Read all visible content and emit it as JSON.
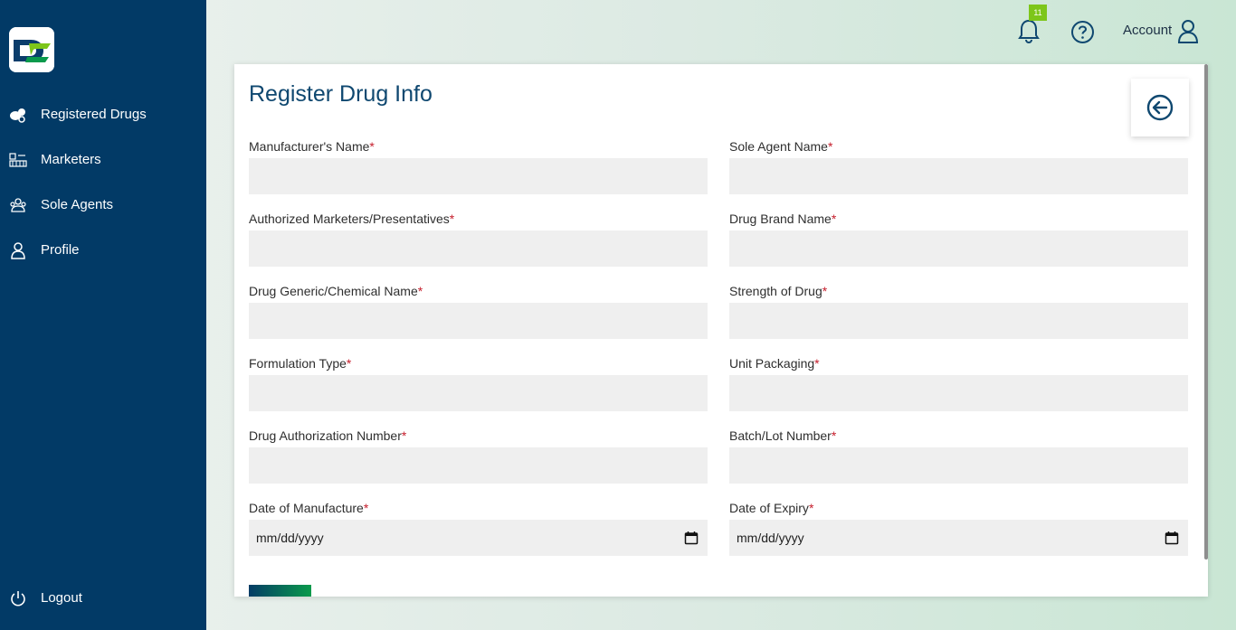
{
  "sidebar": {
    "items": [
      {
        "label": "Registered Drugs",
        "icon": "pills-icon"
      },
      {
        "label": "Marketers",
        "icon": "marketers-icon"
      },
      {
        "label": "Sole Agents",
        "icon": "sole-agents-icon"
      },
      {
        "label": "Profile",
        "icon": "user-icon"
      }
    ],
    "logout_label": "Logout"
  },
  "topbar": {
    "notification_count": "11",
    "account_label": "Account"
  },
  "form": {
    "title": "Register Drug Info",
    "required_marker": "*",
    "fields": [
      {
        "label": "Manufacturer's Name",
        "value": ""
      },
      {
        "label": "Sole Agent Name",
        "value": ""
      },
      {
        "label": "Authorized Marketers/Presentatives",
        "value": ""
      },
      {
        "label": "Drug Brand Name",
        "value": ""
      },
      {
        "label": "Drug Generic/Chemical Name",
        "value": ""
      },
      {
        "label": "Strength of Drug",
        "value": ""
      },
      {
        "label": "Formulation Type",
        "value": ""
      },
      {
        "label": "Unit Packaging",
        "value": ""
      },
      {
        "label": "Drug Authorization Number",
        "value": ""
      },
      {
        "label": "Batch/Lot Number",
        "value": ""
      },
      {
        "label": "Date of Manufacture",
        "value": "mm/dd/yyyy"
      },
      {
        "label": "Date of Expiry",
        "value": "mm/dd/yyyy"
      }
    ]
  },
  "colors": {
    "sidebar_bg": "#023a66",
    "accent_green": "#7dc61a",
    "required": "#c51d2b",
    "title": "#0f4870"
  }
}
